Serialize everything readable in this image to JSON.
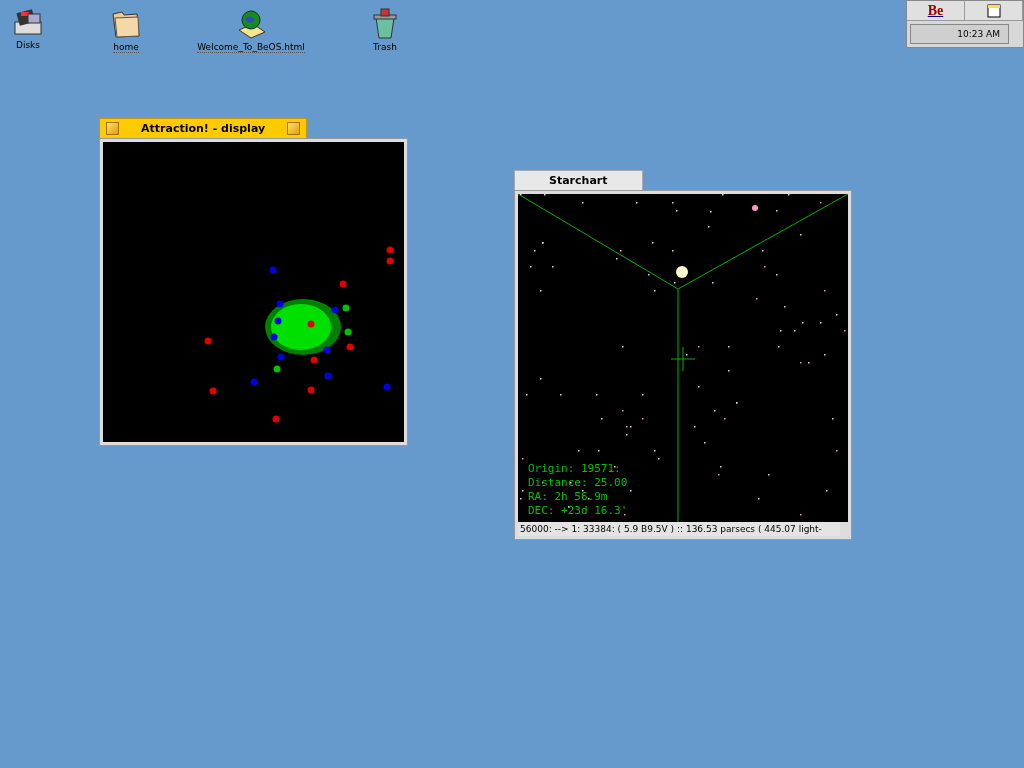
{
  "desktop_icons": [
    {
      "kind": "disks",
      "label": "Disks",
      "underlined": false
    },
    {
      "kind": "folder",
      "label": "home",
      "underlined": true
    },
    {
      "kind": "document",
      "label": "Welcome_To_BeOS.html",
      "underlined": true
    },
    {
      "kind": "trash",
      "label": "Trash",
      "underlined": false
    }
  ],
  "deskbar": {
    "logo": "Be",
    "clock": "10:23 AM"
  },
  "windows": [
    {
      "kind": "attraction",
      "title": "Attraction! - display",
      "active": true
    },
    {
      "kind": "starchart",
      "title": "Starchart",
      "active": false,
      "overlay": [
        "Origin: 19571:",
        "Distance: 25.00",
        "RA: 2h 56.9m",
        "DEC: +23d 16.3'"
      ],
      "status": "56000:  --> 1: 33384:  ( 5.9 B9.5V )  ::  136.53 parsecs ( 445.07 light-"
    }
  ]
}
